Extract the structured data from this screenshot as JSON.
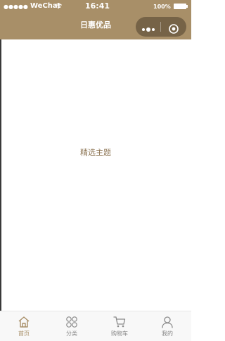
{
  "status_bar": {
    "signal": "●●●●●",
    "carrier": "WeChat",
    "time": "16:41",
    "battery": "100%"
  },
  "nav": {
    "title": "日惠优品"
  },
  "content": {
    "section_label": "精选主题"
  },
  "tabbar": {
    "items": [
      {
        "label": "首页",
        "icon": "home-icon",
        "active": true
      },
      {
        "label": "分类",
        "icon": "category-icon",
        "active": false
      },
      {
        "label": "购物车",
        "icon": "cart-icon",
        "active": false
      },
      {
        "label": "我的",
        "icon": "user-icon",
        "active": false
      }
    ]
  },
  "colors": {
    "brand": "#a88f68",
    "inactive": "#8a8a8a",
    "tabbar_bg": "#f8f8f8"
  }
}
